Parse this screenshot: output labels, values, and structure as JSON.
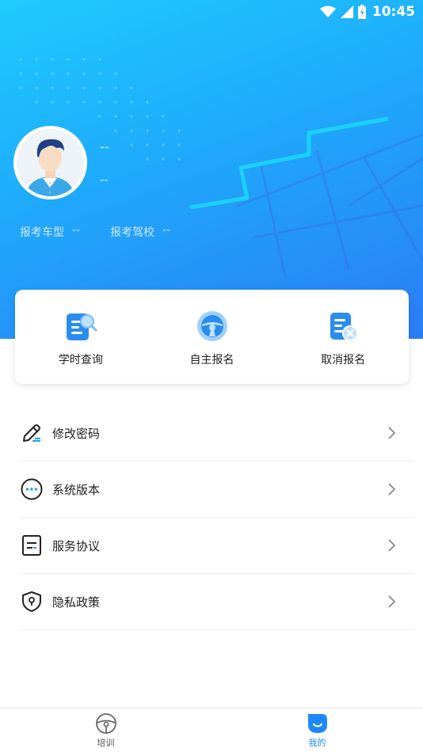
{
  "status_bar": {
    "time": "10:45"
  },
  "profile": {
    "name": "--",
    "subtitle": "--",
    "vehicle_type_label": "报考车型",
    "vehicle_type_value": "--",
    "school_label": "报考驾校",
    "school_value": "--"
  },
  "quick_actions": [
    {
      "label": "学时查询",
      "icon": "document-search-icon"
    },
    {
      "label": "自主报名",
      "icon": "steering-wheel-icon"
    },
    {
      "label": "取消报名",
      "icon": "document-cancel-icon"
    }
  ],
  "menu": [
    {
      "label": "修改密码",
      "icon": "pencil-icon"
    },
    {
      "label": "系统版本",
      "icon": "more-dots-icon"
    },
    {
      "label": "服务协议",
      "icon": "agreement-document-icon"
    },
    {
      "label": "隐私政策",
      "icon": "shield-lock-icon"
    }
  ],
  "bottom_nav": [
    {
      "label": "培训",
      "icon": "steering-wheel-icon",
      "active": false
    },
    {
      "label": "我的",
      "icon": "profile-icon",
      "active": true
    }
  ],
  "colors": {
    "accent": "#1e88ff",
    "header_start": "#1ecbff",
    "header_end": "#2b7cf6"
  }
}
